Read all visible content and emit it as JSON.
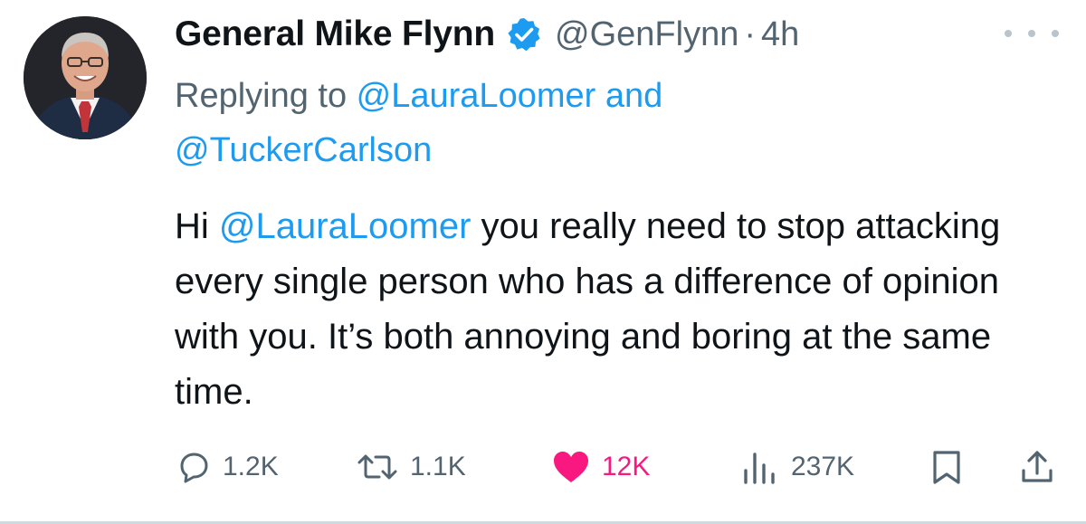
{
  "author": {
    "display_name": "General Mike Flynn",
    "handle": "@GenFlynn",
    "separator": "·",
    "time": "4h",
    "verified_icon": "verified-badge-icon",
    "verified_color": "#1d9bf0"
  },
  "reply_context": {
    "prefix": "Replying to ",
    "mention_1": "@LauraLoomer",
    "connector": " and",
    "mention_2": "@TuckerCarlson"
  },
  "tweet": {
    "greeting": "Hi ",
    "mention": "@LauraLoomer",
    "text": " you really need to stop attacking every single person who has a difference of opinion with you. It’s both annoying and boring at the same time."
  },
  "actions": {
    "replies": "1.2K",
    "reposts": "1.1K",
    "likes": "12K",
    "views": "237K",
    "icons": [
      "reply-icon",
      "repost-icon",
      "like-icon",
      "views-icon",
      "bookmark-icon",
      "share-icon"
    ]
  },
  "colors": {
    "accent": "#1d9bf0",
    "muted": "#536471",
    "like": "#f91880",
    "text": "#0f1419"
  }
}
